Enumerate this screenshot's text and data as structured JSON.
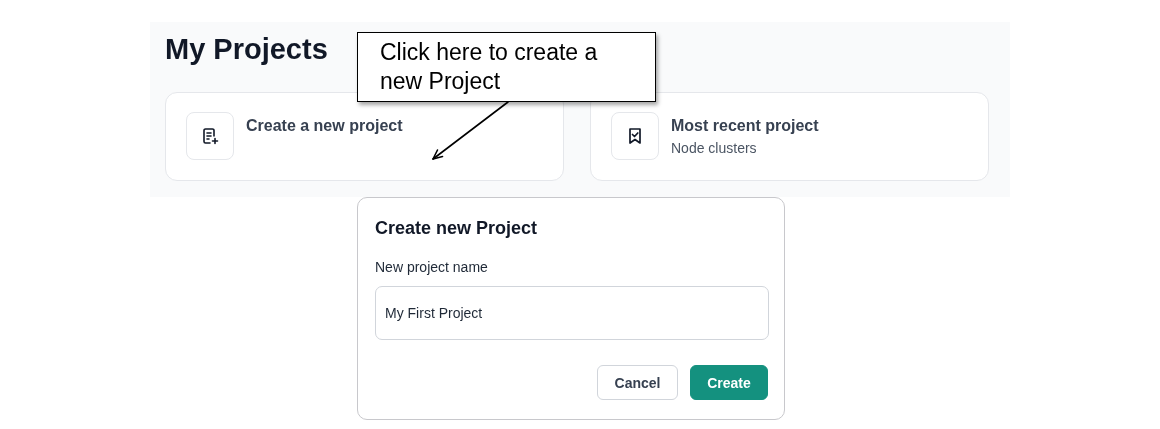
{
  "page": {
    "title": "My Projects"
  },
  "cards": [
    {
      "kind": "create",
      "title": "Create a new project"
    },
    {
      "kind": "recent",
      "title": "Most recent project",
      "subtitle": "Node clusters"
    }
  ],
  "callout": {
    "text": "Click here to create a new Project"
  },
  "dialog": {
    "title": "Create new Project",
    "field_label": "New project name",
    "value": "My First Project",
    "buttons": [
      {
        "label": "Cancel",
        "kind": "secondary"
      },
      {
        "label": "Create",
        "kind": "primary"
      }
    ]
  }
}
